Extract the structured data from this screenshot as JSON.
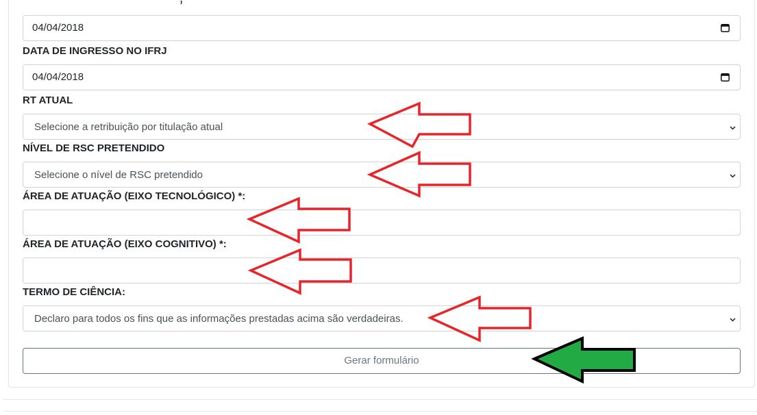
{
  "form": {
    "fields": [
      {
        "id": "date_top",
        "value": "04/04/2018"
      },
      {
        "id": "date_ingresso",
        "label": "DATA DE INGRESSO NO IFRJ",
        "value": "04/04/2018"
      },
      {
        "id": "rt_atual",
        "label": "RT ATUAL",
        "value": "Selecione a retribuição por titulação atual"
      },
      {
        "id": "nivel_rsc",
        "label": "NÍVEL DE RSC PRETENDIDO",
        "value": "Selecione o nível de RSC pretendido"
      },
      {
        "id": "area_tecnologico",
        "label": "ÁREA DE ATUAÇÃO (EIXO TECNOLÓGICO) *:",
        "value": ""
      },
      {
        "id": "area_cognitivo",
        "label": "ÁREA DE ATUAÇÃO (EIXO COGNITIVO) *:",
        "value": ""
      },
      {
        "id": "termo_ciencia",
        "label": "TERMO DE CIÊNCIA:",
        "value": "Declaro para todos os fins que as informações prestadas acima são verdadeiras."
      }
    ],
    "submit_label": "Gerar formulário"
  },
  "annotations": {
    "red_arrow_color": "#e8242b",
    "green_arrow_color": "#22aa44",
    "outline_color": "#000000"
  }
}
